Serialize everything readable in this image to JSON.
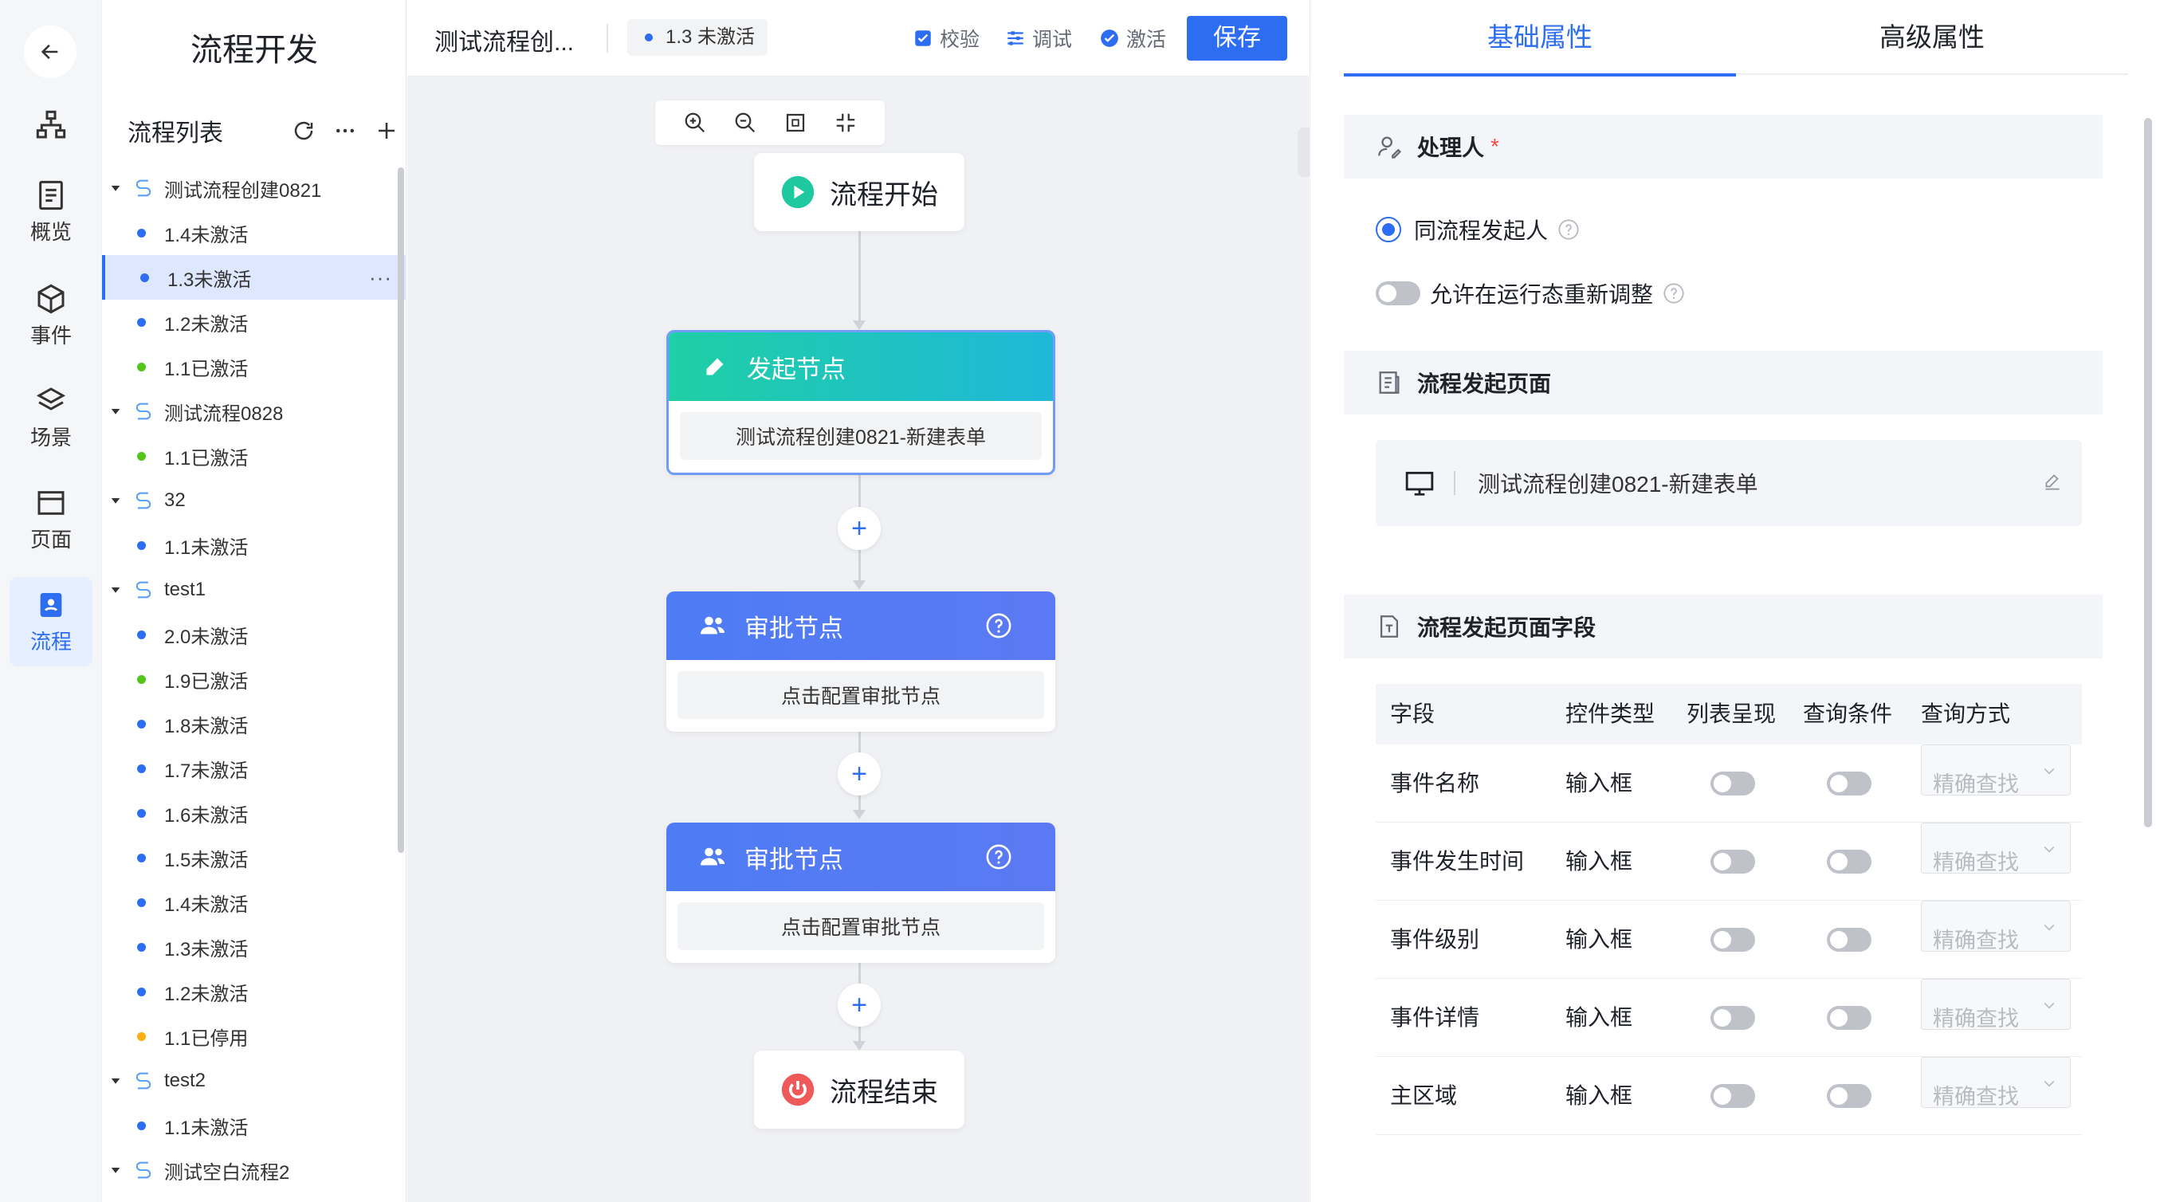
{
  "rail": {
    "items": [
      {
        "label": "",
        "icon": "org-chart-icon"
      },
      {
        "label": "概览",
        "icon": "document-icon"
      },
      {
        "label": "事件",
        "icon": "cube-icon"
      },
      {
        "label": "场景",
        "icon": "layers-icon"
      },
      {
        "label": "页面",
        "icon": "window-icon"
      },
      {
        "label": "流程",
        "icon": "flow-icon"
      }
    ]
  },
  "tree": {
    "title": "流程开发",
    "list_label": "流程列表",
    "nodes": [
      {
        "type": "group",
        "name": "测试流程创建0821"
      },
      {
        "type": "child",
        "name": "1.4未激活",
        "status": "inactive"
      },
      {
        "type": "child",
        "name": "1.3未激活",
        "status": "inactive",
        "selected": true
      },
      {
        "type": "child",
        "name": "1.2未激活",
        "status": "inactive"
      },
      {
        "type": "child",
        "name": "1.1已激活",
        "status": "active"
      },
      {
        "type": "group",
        "name": "测试流程0828"
      },
      {
        "type": "child",
        "name": "1.1已激活",
        "status": "active"
      },
      {
        "type": "group",
        "name": "32"
      },
      {
        "type": "child",
        "name": "1.1未激活",
        "status": "inactive"
      },
      {
        "type": "group",
        "name": "test1"
      },
      {
        "type": "child",
        "name": "2.0未激活",
        "status": "inactive"
      },
      {
        "type": "child",
        "name": "1.9已激活",
        "status": "active"
      },
      {
        "type": "child",
        "name": "1.8未激活",
        "status": "inactive"
      },
      {
        "type": "child",
        "name": "1.7未激活",
        "status": "inactive"
      },
      {
        "type": "child",
        "name": "1.6未激活",
        "status": "inactive"
      },
      {
        "type": "child",
        "name": "1.5未激活",
        "status": "inactive"
      },
      {
        "type": "child",
        "name": "1.4未激活",
        "status": "inactive"
      },
      {
        "type": "child",
        "name": "1.3未激活",
        "status": "inactive"
      },
      {
        "type": "child",
        "name": "1.2未激活",
        "status": "inactive"
      },
      {
        "type": "child",
        "name": "1.1已停用",
        "status": "disabled"
      },
      {
        "type": "group",
        "name": "test2"
      },
      {
        "type": "child",
        "name": "1.1未激活",
        "status": "inactive"
      },
      {
        "type": "group",
        "name": "测试空白流程2"
      }
    ],
    "more": "···"
  },
  "toolbar": {
    "process_title": "测试流程创...",
    "version": "1.3 未激活",
    "validate": "校验",
    "debug": "调试",
    "activate": "激活",
    "save": "保存"
  },
  "flow": {
    "start": "流程开始",
    "end": "流程结束",
    "initiator": {
      "title": "发起节点",
      "body": "测试流程创建0821-新建表单"
    },
    "approvals": [
      {
        "title": "审批节点",
        "body": "点击配置审批节点"
      },
      {
        "title": "审批节点",
        "body": "点击配置审批节点"
      }
    ],
    "add": "+"
  },
  "panel": {
    "tabs": [
      "基础属性",
      "高级属性"
    ],
    "handler": {
      "title": "处理人",
      "required": "*",
      "option": "同流程发起人",
      "toggle_label": "允许在运行态重新调整"
    },
    "start_page": {
      "title": "流程发起页面",
      "value": "测试流程创建0821-新建表单"
    },
    "fields": {
      "title": "流程发起页面字段",
      "columns": [
        "字段",
        "控件类型",
        "列表呈现",
        "查询条件",
        "查询方式"
      ],
      "rows": [
        {
          "field": "事件名称",
          "control": "输入框",
          "query": "精确查找"
        },
        {
          "field": "事件发生时间",
          "control": "输入框",
          "query": "精确查找"
        },
        {
          "field": "事件级别",
          "control": "输入框",
          "query": "精确查找"
        },
        {
          "field": "事件详情",
          "control": "输入框",
          "query": "精确查找"
        },
        {
          "field": "主区域",
          "control": "输入框",
          "query": "精确查找"
        }
      ]
    }
  },
  "colors": {
    "accent": "#2c6df2",
    "inactive_dot": "#2c6df2",
    "active_dot": "#52c41a",
    "disabled_dot": "#faad14",
    "start_head": "#1fc9b4",
    "approval_head": "#4d7cf5"
  }
}
